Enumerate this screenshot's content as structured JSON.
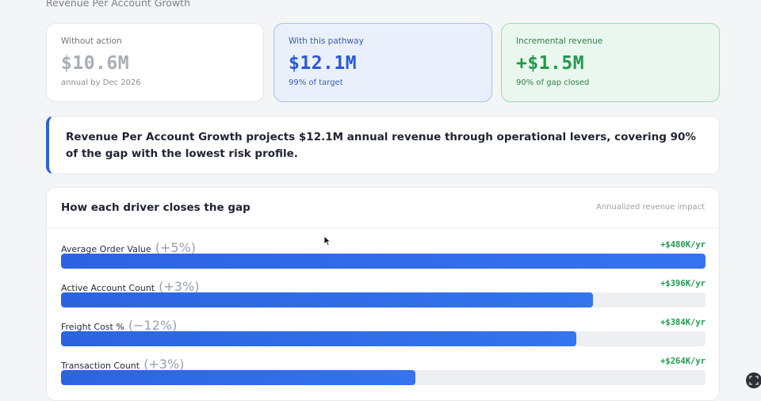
{
  "section": {
    "title": "Revenue Per Account Growth"
  },
  "cards": {
    "without_action": {
      "label": "Without action",
      "value": "$10.6M",
      "sub": "annual by Dec 2026"
    },
    "with_pathway": {
      "label": "With this pathway",
      "value": "$12.1M",
      "sub": "99% of target"
    },
    "incremental": {
      "label": "Incremental revenue",
      "value": "+$1.5M",
      "sub": "90% of gap closed"
    }
  },
  "insight": {
    "text": "Revenue Per Account Growth projects $12.1M annual revenue through operational levers, covering 90% of the gap with the lowest risk profile."
  },
  "drivers": {
    "title": "How each driver closes the gap",
    "note": "Annualized revenue impact",
    "items": [
      {
        "name": "Average Order Value",
        "change": "(+5%)",
        "impact": "+$480K/yr",
        "progress": 1.0
      },
      {
        "name": "Active Account Count",
        "change": "(+3%)",
        "impact": "+$396K/yr",
        "progress": 0.825
      },
      {
        "name": "Freight Cost %",
        "change": "(−12%)",
        "impact": "+$384K/yr",
        "progress": 0.8
      },
      {
        "name": "Transaction Count",
        "change": "(+3%)",
        "impact": "+$264K/yr",
        "progress": 0.55
      }
    ]
  },
  "colors": {
    "accent_blue": "#2c63e0",
    "positive_green": "#1f9a4c"
  },
  "icons": {
    "cursor": "mouse-pointer-icon",
    "corner": "expand-icon"
  }
}
